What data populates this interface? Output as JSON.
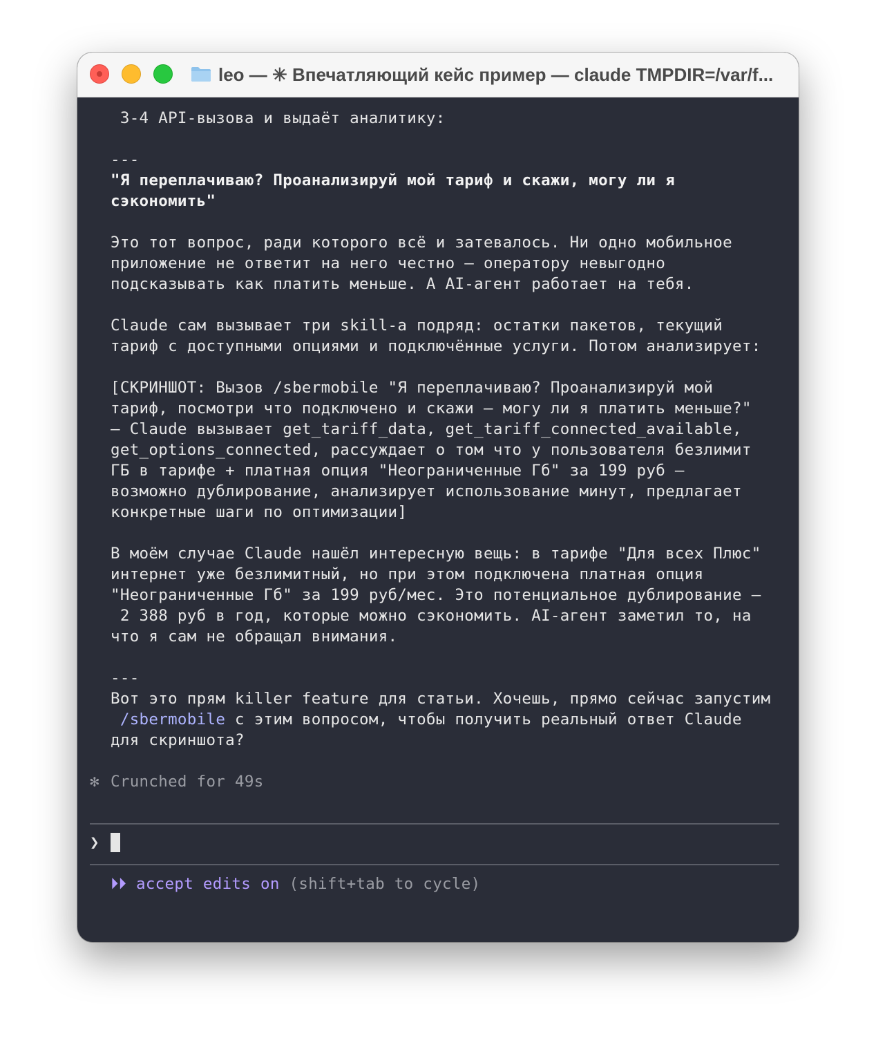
{
  "window": {
    "title": "leo — ✳ Впечатляющий кейс пример — claude TMPDIR=/var/f..."
  },
  "terminal": {
    "lines": [
      " 3-4 API-вызова и выдаёт аналитику:",
      "",
      "---",
      "\"Я переплачиваю? Проанализируй мой тариф и скажи, могу ли я",
      "сэкономить\"",
      "",
      "Это тот вопрос, ради которого всё и затевалось. Ни одно мобильное",
      "приложение не ответит на него честно — оператору невыгодно",
      "подсказывать как платить меньше. А AI-агент работает на тебя.",
      "",
      "Claude сам вызывает три skill-а подряд: остатки пакетов, текущий",
      "тариф с доступными опциями и подключённые услуги. Потом анализирует:",
      "",
      "[СКРИНШОТ: Вызов /sbermobile \"Я переплачиваю? Проанализируй мой",
      "тариф, посмотри что подключено и скажи — могу ли я платить меньше?\"",
      "— Claude вызывает get_tariff_data, get_tariff_connected_available,",
      "get_options_connected, рассуждает о том что у пользователя безлимит",
      "ГБ в тарифе + платная опция \"Неограниченные Гб\" за 199 руб —",
      "возможно дублирование, анализирует использование минут, предлагает",
      "конкретные шаги по оптимизации]",
      "",
      "В моём случае Claude нашёл интересную вещь: в тарифе \"Для всех Плюс\"",
      "интернет уже безлимитный, но при этом подключена платная опция",
      "\"Неограниченные Гб\" за 199 руб/мес. Это потенциальное дублирование —",
      " 2 388 руб в год, которые можно сэкономить. AI-агент заметил то, на",
      "что я сам не обращал внимания.",
      "",
      "---",
      "Вот это прям killer feature для статьи. Хочешь, прямо сейчас запустим"
    ],
    "last_line_link": "/sbermobile",
    "last_line_rest": " с этим вопросом, чтобы получить реальный ответ Claude",
    "last_line_end": "для скриншота?",
    "status_star": "✻",
    "status_text": "Crunched for 49s",
    "prompt_symbol": "❯",
    "mode_arrows": "⏵⏵",
    "mode_label": "accept edits on",
    "mode_hint": " (shift+tab to cycle)"
  }
}
